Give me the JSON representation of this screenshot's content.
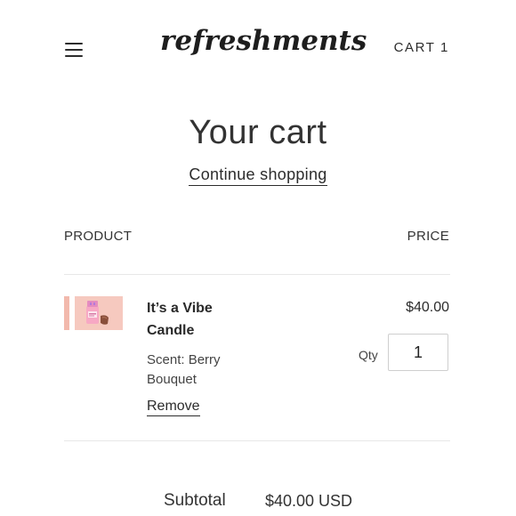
{
  "header": {
    "logo_text": "refreshments",
    "cart_label": "CART",
    "cart_count": "1"
  },
  "cart": {
    "title": "Your cart",
    "continue_shopping": "Continue shopping",
    "columns": {
      "product": "PRODUCT",
      "price": "PRICE"
    },
    "items": [
      {
        "name": "It’s a Vibe Candle",
        "option_label": "Scent:",
        "option_value": "Berry Bouquet",
        "remove_label": "Remove",
        "price": "$40.00",
        "qty_label": "Qty",
        "qty": "1"
      }
    ],
    "subtotal_label": "Subtotal",
    "subtotal_value": "$40.00 USD"
  },
  "colors": {
    "thumb_bg": "#f6c9bf",
    "text": "#2c2c2c"
  }
}
